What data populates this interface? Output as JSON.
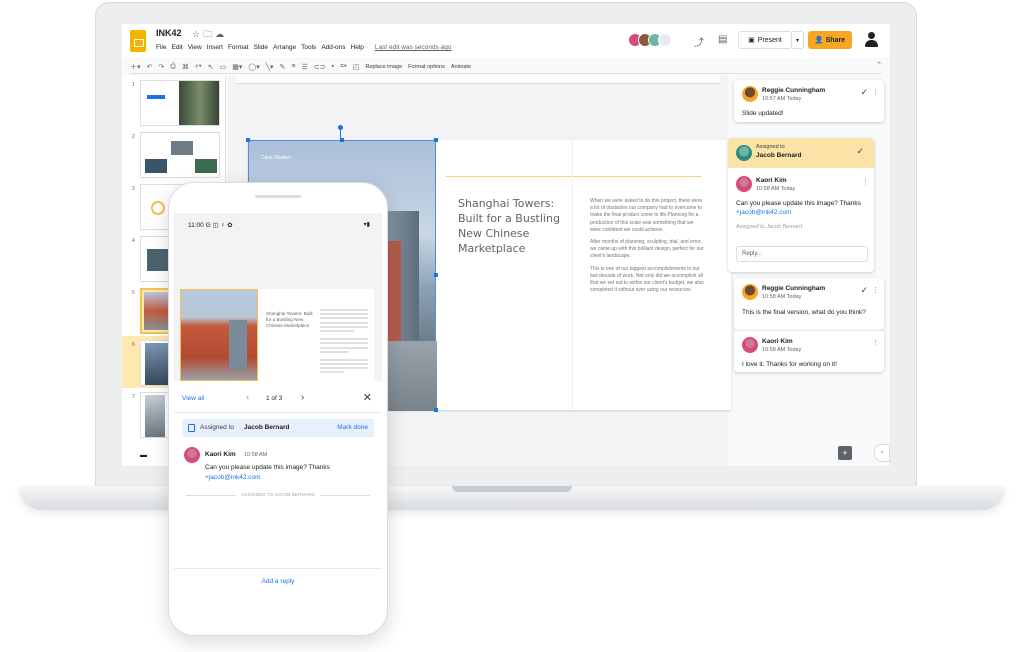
{
  "app": {
    "doc_title": "INK42",
    "title_icons": [
      "star-icon",
      "folder-icon",
      "cloud-icon"
    ],
    "menu": [
      "File",
      "Edit",
      "View",
      "Insert",
      "Format",
      "Slide",
      "Arrange",
      "Tools",
      "Add-ons",
      "Help"
    ],
    "last_edit": "Last edit was seconds ago",
    "present_label": "Present",
    "share_label": "Share",
    "accent_color": "#f6a623"
  },
  "toolbar": {
    "replace_image": "Replace image",
    "format_options": "Format options",
    "animate": "Animate"
  },
  "filmstrip": {
    "slide_numbers": [
      "1",
      "2",
      "3",
      "4",
      "5",
      "6",
      "7"
    ],
    "active_slide": "5"
  },
  "slide": {
    "caption": "Case Studies",
    "title": "Shanghai Towers: Built for a Bustling New Chinese Marketplace",
    "paragraphs": [
      "When we were asked to do this project, there were a lot of obstacles our company had to overcome to make the final product come to life.Planning for a production of this scale was something that we were confident we could achieve.",
      "After months of planning, sculpting, trial, and error, we came up with this brilliant design, perfect for our client's landscape.",
      "This is one of our biggest accomplishments in our last decade of work. Not only did we accomplish all that we set out to within our client's budget, we also completed it without over using our resources."
    ]
  },
  "comments": {
    "c1": {
      "author": "Reggie Cunningham",
      "time": "10:57 AM Today",
      "text": "Slide updated!"
    },
    "assigned": {
      "label": "Assigned to",
      "name": "Jacob Bernard"
    },
    "c2": {
      "author": "Kaori Kim",
      "time": "10:58 AM Today",
      "text": "Can you please update this image? Thanks ",
      "mention": "+jacob@ink42.com",
      "meta": "Assigned to Jacob Bernard",
      "reply_placeholder": "Reply..."
    },
    "c3": {
      "author": "Reggie Cunningham",
      "time": "10:58 AM Today",
      "text": "This is the final version, what do you think?"
    },
    "c4": {
      "author": "Kaori Kim",
      "time": "10:58 AM Today",
      "text": "I love it. Thanks for working on it!"
    }
  },
  "phone": {
    "time": "11:00",
    "status_icons": "G ◫ ♀ ✿",
    "mini_title": "Shanghai Towers: Built for a Bustling New Chinese Marketplace",
    "view_all": "View all",
    "count": "1 of 3",
    "assigned_label": "Assigned to",
    "assigned_name": "Jacob Bernard",
    "mark_done": "Mark done",
    "author": "Kaori Kim",
    "time_stamp": "10:58 AM",
    "text": "Can you please update this image? Thanks ",
    "mention": "+jacob@ink42.com",
    "assigned_note": "ASSIGNED TO JACOB BERNARD",
    "add_reply": "Add a reply"
  }
}
